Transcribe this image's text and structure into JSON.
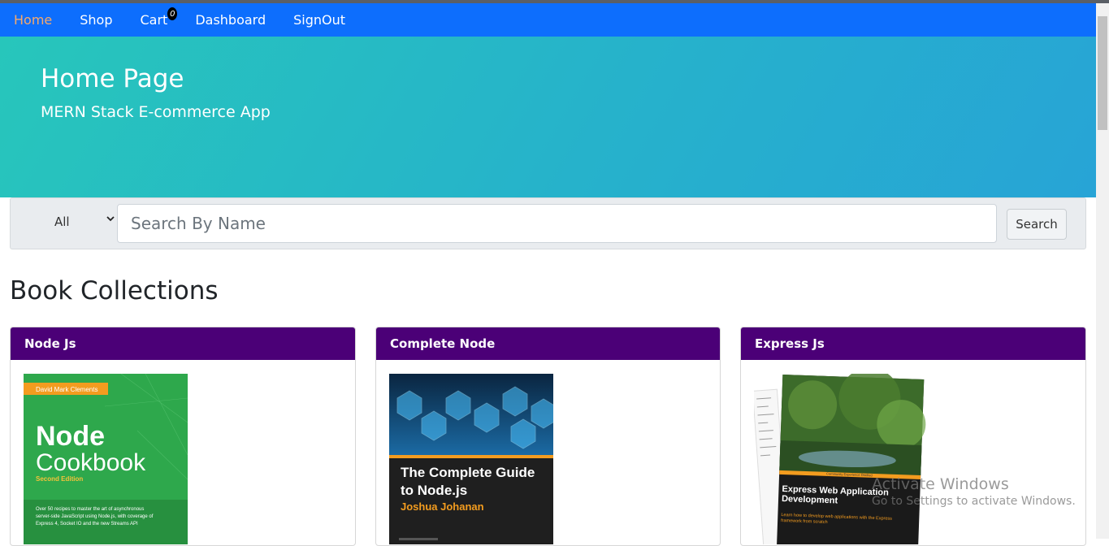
{
  "nav": {
    "items": [
      {
        "label": "Home",
        "active": true
      },
      {
        "label": "Shop",
        "active": false
      },
      {
        "label": "Cart",
        "active": false,
        "badge": "0"
      },
      {
        "label": "Dashboard",
        "active": false
      },
      {
        "label": "SignOut",
        "active": false
      }
    ]
  },
  "hero": {
    "title": "Home Page",
    "subtitle": "MERN Stack E-commerce App"
  },
  "search": {
    "category_selected": "All",
    "placeholder": "Search By Name",
    "button_label": "Search"
  },
  "collections": {
    "title": "Book Collections",
    "books": [
      {
        "name": "Node Js",
        "cover": {
          "author": "David Mark Clements",
          "title_line1": "Node",
          "title_line2": "Cookbook",
          "edition": "Second Edition",
          "blurb1": "Over 50 recipes to master the art of asynchronous",
          "blurb2": "server-side JavaScript using Node.js, with coverage of",
          "blurb3": "Express 4, Socket IO and the new Streams  API"
        }
      },
      {
        "name": "Complete Node",
        "cover": {
          "title_line1": "The Complete Guide",
          "title_line2": "to Node.js",
          "author": "Joshua Johanan"
        }
      },
      {
        "name": "Express Js",
        "cover": {
          "banner": "Community Experience Distilled",
          "title_line1": "Express Web Application",
          "title_line2": "Development",
          "blurb1": "Learn how to develop web applications with the Express",
          "blurb2": "framework from scratch"
        }
      }
    ]
  },
  "watermark": {
    "line1": "Activate Windows",
    "line2": "Go to Settings to activate Windows."
  },
  "colors": {
    "navbar": "#0d6efd",
    "active_nav": "#f6a96b",
    "card_header": "#4b0077"
  }
}
